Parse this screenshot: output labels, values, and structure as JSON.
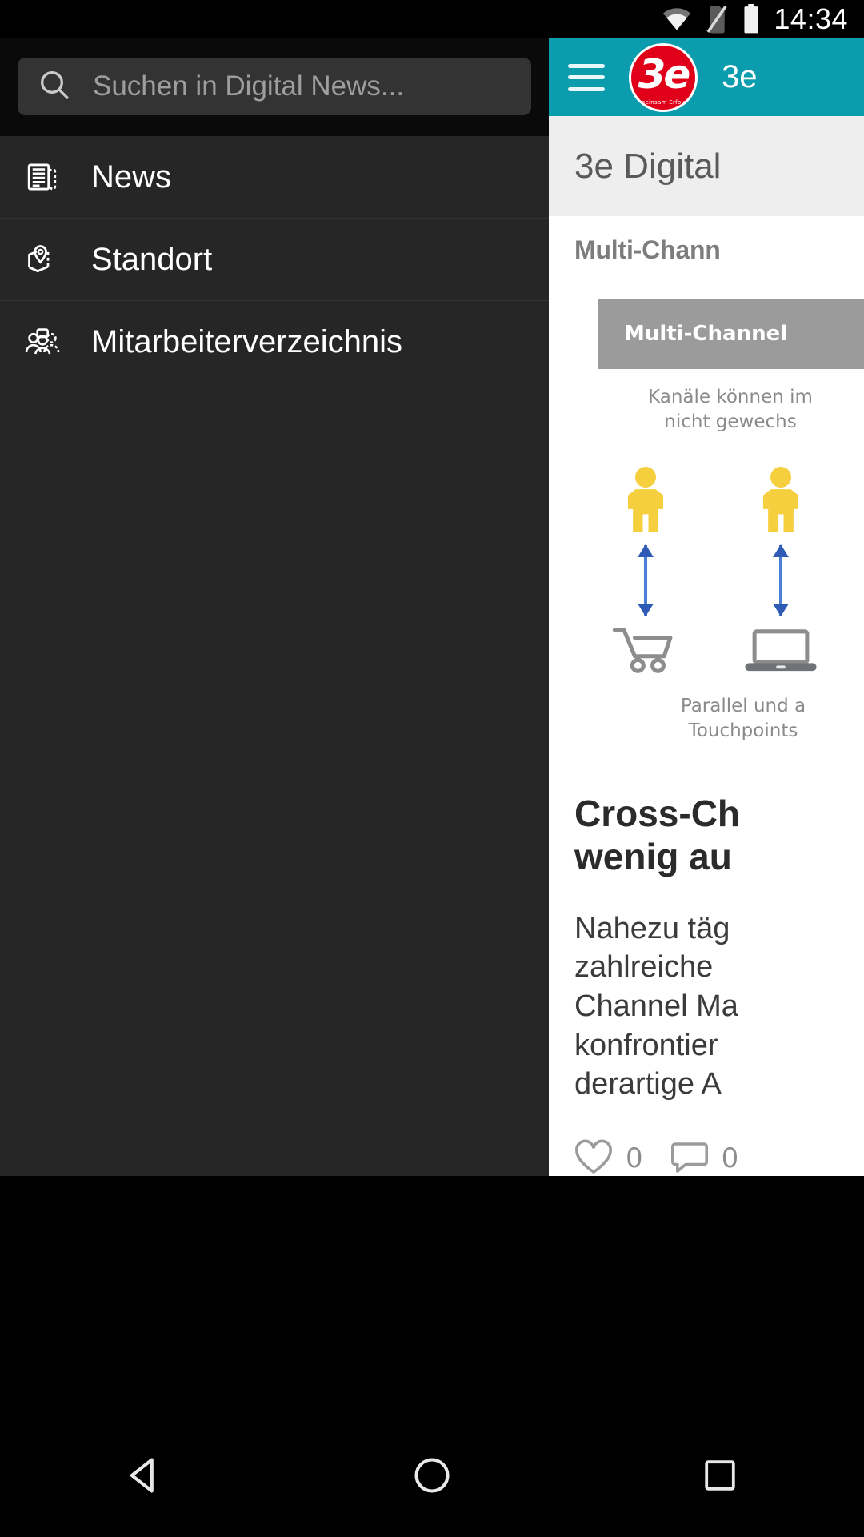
{
  "status_bar": {
    "time": "14:34",
    "icons": [
      "wifi-icon",
      "no-sim-icon",
      "battery-icon"
    ]
  },
  "drawer": {
    "search": {
      "placeholder": "Suchen in Digital News...",
      "value": "",
      "icon": "search-icon"
    },
    "items": [
      {
        "label": "News",
        "icon": "newspaper-icon"
      },
      {
        "label": "Standort",
        "icon": "map-pin-icon"
      },
      {
        "label": "Mitarbeiterverzeichnis",
        "icon": "people-group-icon"
      }
    ]
  },
  "app": {
    "appbar": {
      "menu_icon": "hamburger-icon",
      "logo_text": "3e",
      "logo_subtext": "Gemeinsam Erfolgreich",
      "title": "3e"
    },
    "page_title": "3e Digital",
    "article": {
      "kicker": "Multi-Chann",
      "infographic": {
        "band_label": "Multi-Channel",
        "caption": "Kanäle können im\nnicht gewechs",
        "footer": "Parallel und a\nTouchpoints",
        "channel_icons": [
          "shopping-cart-icon",
          "laptop-icon"
        ]
      },
      "title": "Cross-Ch\nwenig au",
      "body": "Nahezu täg\nzahlreiche\nChannel Ma\nkonfrontier\nderartige A",
      "reactions": {
        "like_icon": "heart-icon",
        "like_count": "0",
        "comment_icon": "comment-icon",
        "comment_count": "0"
      }
    }
  },
  "navigation_bar": {
    "back": "back-triangle-icon",
    "home": "home-circle-icon",
    "recents": "recents-square-icon"
  },
  "colors": {
    "accent_teal": "#0b9cad",
    "logo_red": "#e1001a",
    "drawer_bg": "#262626",
    "figure_yellow": "#f6cf3f",
    "arrow_blue": "#4a7fd4"
  }
}
